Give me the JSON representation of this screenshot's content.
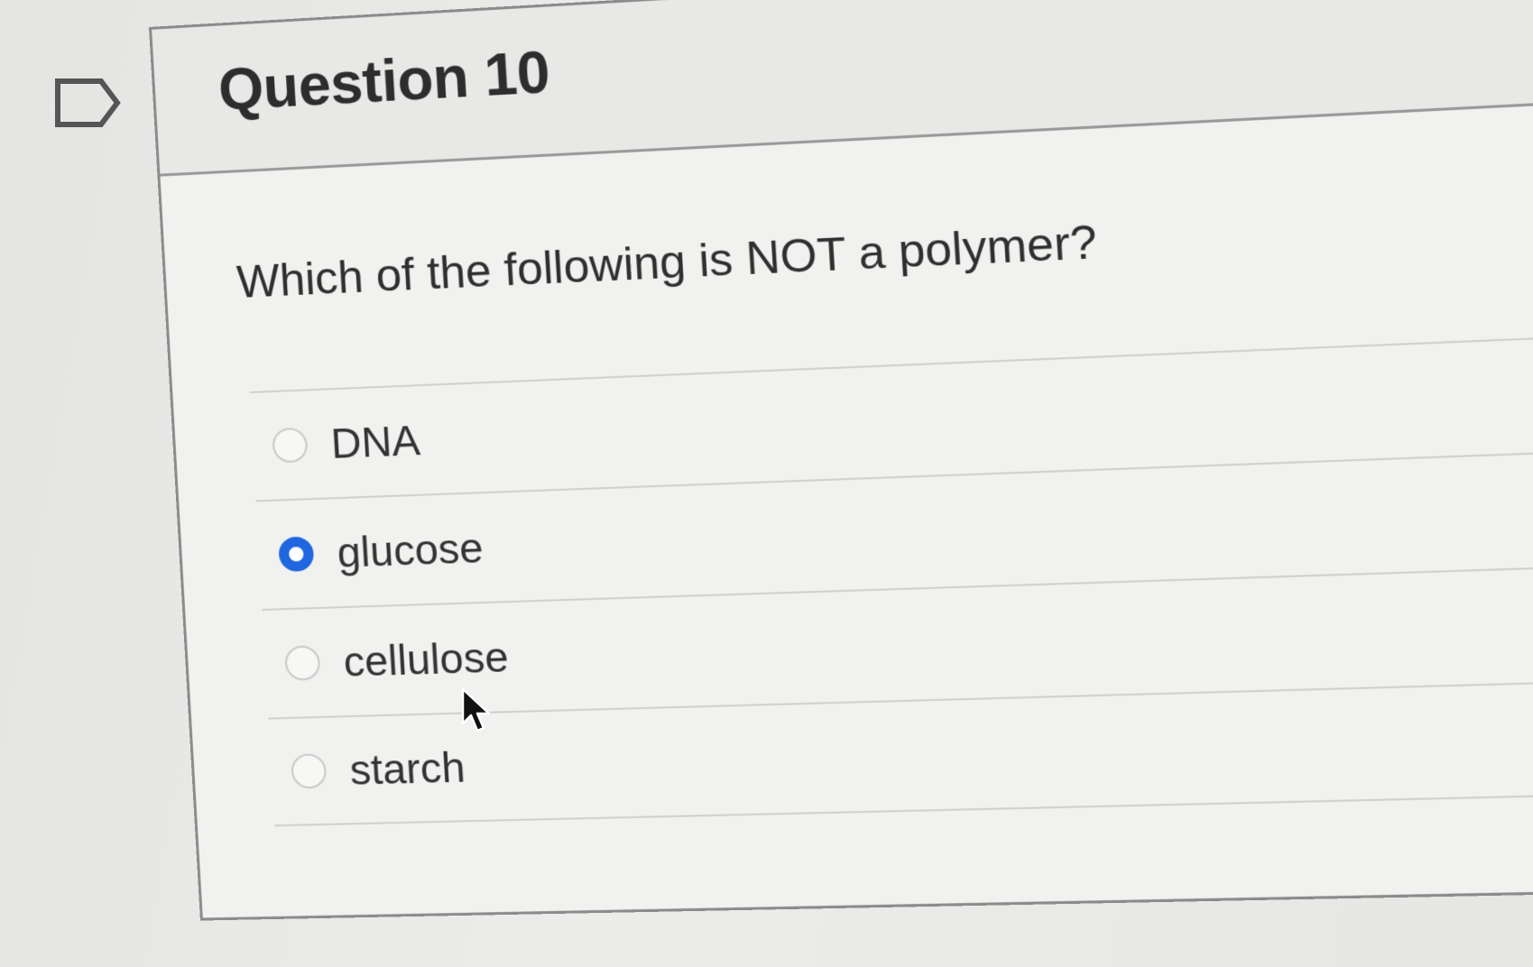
{
  "question": {
    "title": "Question 10",
    "text": "Which of the following is NOT a polymer?"
  },
  "answers": [
    {
      "label": "DNA",
      "selected": false
    },
    {
      "label": "glucose",
      "selected": true
    },
    {
      "label": "cellulose",
      "selected": false
    },
    {
      "label": "starch",
      "selected": false
    }
  ],
  "colors": {
    "accent": "#1f66e0",
    "text": "#2d2d2d",
    "border": "#8b8b8b"
  },
  "icons": {
    "flag": "bookmark-flag-icon",
    "cursor": "mouse-pointer-icon"
  }
}
